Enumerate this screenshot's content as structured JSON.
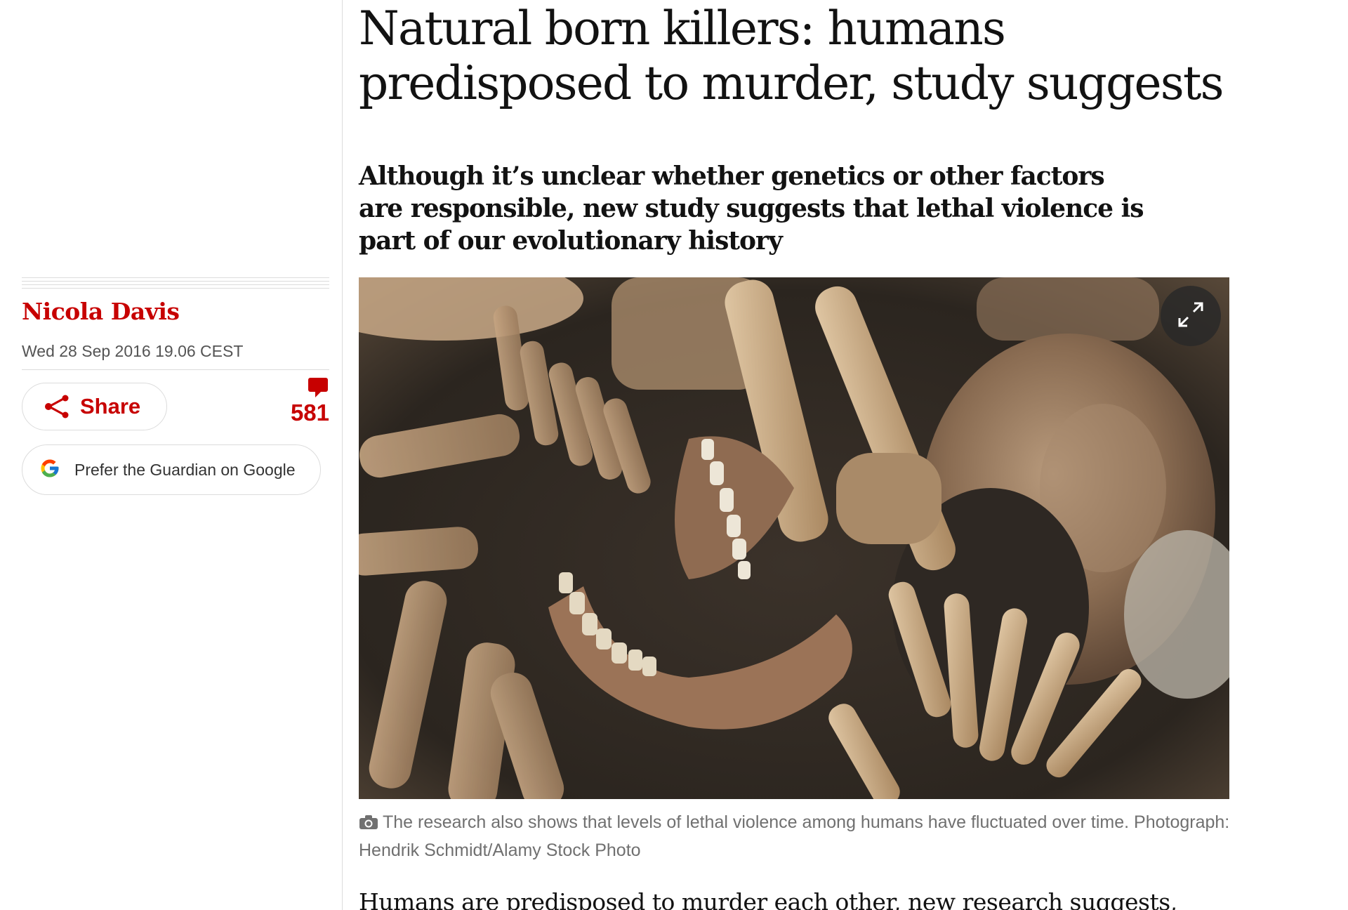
{
  "article": {
    "headline": "Natural born killers: humans predisposed to murder, study suggests",
    "standfirst": "Although it’s unclear whether genetics or other factors are responsible, new study suggests that lethal violence is part of our evolutionary history",
    "body_first_line": "Humans are predisposed to murder each other, new research suggests,"
  },
  "byline": {
    "author": "Nicola Davis",
    "date": "Wed 28 Sep 2016 19.06 CEST"
  },
  "actions": {
    "share_label": "Share",
    "comment_count": "581",
    "google_label": "Prefer the Guardian on Google"
  },
  "media": {
    "caption": "The research also shows that levels of lethal violence among humans have fluctuated over time. Photograph: Hendrik Schmidt/Alamy Stock Photo",
    "expand_icon": "expand-icon",
    "camera_icon": "camera-icon"
  },
  "colors": {
    "accent": "#c70000",
    "text": "#121212",
    "muted": "#707070",
    "border": "#dcdcdc"
  }
}
